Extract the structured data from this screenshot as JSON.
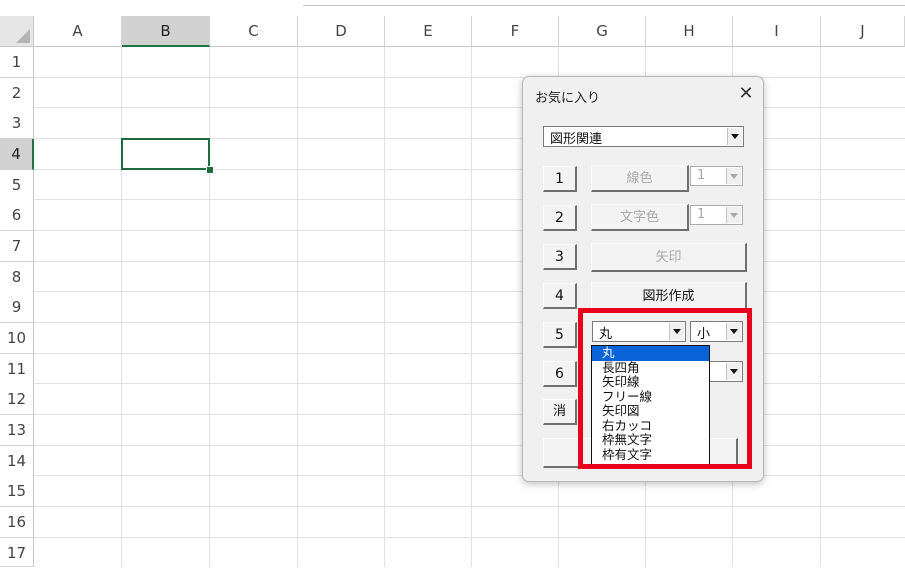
{
  "spreadsheet": {
    "columns": [
      "A",
      "B",
      "C",
      "D",
      "E",
      "F",
      "G",
      "H",
      "I",
      "J"
    ],
    "rows": [
      "1",
      "2",
      "3",
      "4",
      "5",
      "6",
      "7",
      "8",
      "9",
      "10",
      "11",
      "12",
      "13",
      "14",
      "15",
      "16",
      "17"
    ],
    "selected_column": "B",
    "selected_row": "4",
    "accent_color": "#217346"
  },
  "dialog": {
    "title": "お気に入り",
    "close_glyph": "✕",
    "category": {
      "value": "図形関連"
    },
    "rows": [
      {
        "number": "1",
        "label": "線色",
        "combo_value": "1"
      },
      {
        "number": "2",
        "label": "文字色",
        "combo_value": "1"
      },
      {
        "number": "3",
        "label": "矢印"
      },
      {
        "number": "4",
        "label": "図形作成"
      },
      {
        "number": "5",
        "shape_value": "丸",
        "size_value": "小"
      },
      {
        "number": "6"
      }
    ],
    "clear_label": "消",
    "shape_options": [
      "丸",
      "長四角",
      "矢印線",
      "フリー線",
      "矢印図",
      "右カッコ",
      "枠無文字",
      "枠有文字"
    ],
    "selected_option": "丸",
    "highlight_color": "#e8001c"
  }
}
